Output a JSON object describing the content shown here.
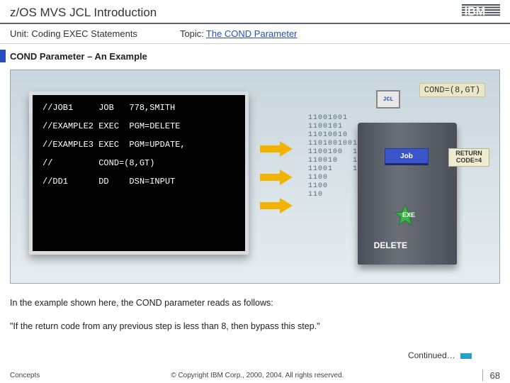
{
  "header": {
    "title": "z/OS MVS JCL Introduction",
    "unit_label": "Unit:",
    "unit_value": "Coding EXEC Statements",
    "topic_label": "Topic:",
    "topic_value": "The COND Parameter",
    "logo": "IBM"
  },
  "section_title": "COND Parameter – An Example",
  "cond_badge": "COND=(8,GT)",
  "terminal": {
    "lines": [
      "//JOB1     JOB   778,SMITH",
      "//EXAMPLE2 EXEC  PGM=DELETE",
      "//EXAMPLE3 EXEC  PGM=UPDATE,",
      "//         COND=(8,GT)",
      "//DD1      DD    DSN=INPUT"
    ]
  },
  "graphic": {
    "jcl": "JCL",
    "job": "Job",
    "exe": "EXE",
    "return_line1": "RETURN",
    "return_line2": "CODE=4",
    "delete": "DELETE"
  },
  "explain": {
    "p1": "In the example shown here, the COND parameter reads as follows:",
    "p2": "\"If the return code from any previous step is less than 8, then bypass this step.\""
  },
  "continued": "Continued…",
  "footer": {
    "left": "Concepts",
    "center": "© Copyright IBM Corp., 2000, 2004. All rights reserved.",
    "page": "68"
  }
}
